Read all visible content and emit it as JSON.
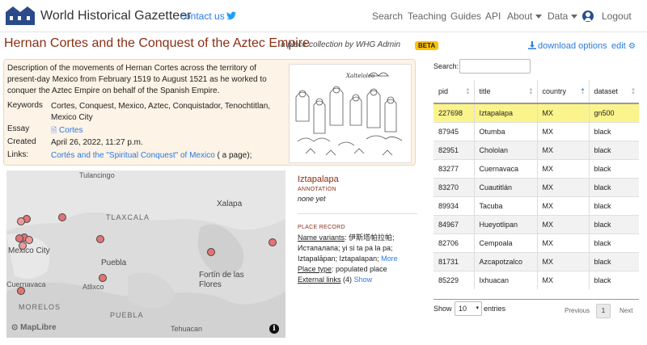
{
  "nav": {
    "brand": "World Historical Gazetteer",
    "contact": "contact us",
    "search": "Search",
    "teaching": "Teaching",
    "guides": "Guides",
    "api": "API",
    "about": "About",
    "data": "Data",
    "logout": "Logout"
  },
  "header": {
    "title": "Hernan Cortes and the Conquest of the Aztec Empire",
    "subtitle": "a place collection by WHG Admin",
    "badge": "BETA",
    "download": "download options",
    "edit": "edit"
  },
  "collection": {
    "description": "Description of the movements of Hernan Cortes across the territory of present-day Mexico from February 1519 to August 1521 as he worked to conquer the Aztec Empire on behalf of the Spanish Empire.",
    "keywords_label": "Keywords",
    "keywords": "Cortes, Conquest, Mexico, Aztec, Conquistador, Tenochtitlan, Mexico City",
    "essay_label": "Essay",
    "essay": "Cortes",
    "created_label": "Created",
    "created": "April 26, 2022, 11:27 p.m.",
    "links_label": "Links:",
    "link_text": "Cortés and the \"Spiritual Conquest\" of Mexico",
    "link_suffix": "( a page);",
    "illustration_caption": "Xaltelolco"
  },
  "map": {
    "labels": {
      "tulancingo": "Tulancingo",
      "tlaxcala": "TLAXCALA",
      "mexico_city": "Mexico City",
      "puebla_city": "Puebla",
      "atlixco": "Atlixco",
      "xalapa": "Xalapa",
      "fortin": "Fortín de las Flores",
      "cuernavaca": "Cuernavaca",
      "morelos": "MORELOS",
      "puebla_state": "PUEBLA",
      "tehuacan": "Tehuacan"
    },
    "attribution": "MapLibre",
    "info": "i"
  },
  "place": {
    "name": "Iztapalapa",
    "annotation_label": "ANNOTATION",
    "annotation": "none yet",
    "record_label": "PLACE RECORD",
    "variants_label": "Name variants",
    "variants": ": 伊斯塔帕拉帕; Истапалапа; yi si ta pa la pa; Iztapalāpan; Iztapalapan;",
    "more": "More",
    "type_label": "Place type",
    "type": ": populated place",
    "links_label": "External links",
    "links_count": "(4)",
    "show": "Show"
  },
  "table": {
    "search_label": "Search:",
    "columns": [
      "pid",
      "title",
      "country",
      "dataset"
    ],
    "rows": [
      [
        "227698",
        "Iztapalapa",
        "MX",
        "gn500"
      ],
      [
        "87945",
        "Otumba",
        "MX",
        "black"
      ],
      [
        "82951",
        "Chololan",
        "MX",
        "black"
      ],
      [
        "83277",
        "Cuernavaca",
        "MX",
        "black"
      ],
      [
        "83270",
        "Cuautitlán",
        "MX",
        "black"
      ],
      [
        "89934",
        "Tacuba",
        "MX",
        "black"
      ],
      [
        "84967",
        "Hueyotlipan",
        "MX",
        "black"
      ],
      [
        "82706",
        "Cempoala",
        "MX",
        "black"
      ],
      [
        "81731",
        "Azcapotzalco",
        "MX",
        "black"
      ],
      [
        "85229",
        "Ixhuacan",
        "MX",
        "black"
      ]
    ],
    "show_label": "Show",
    "page_size": "10",
    "entries_label": "entries",
    "previous": "Previous",
    "page": "1",
    "next": "Next"
  }
}
